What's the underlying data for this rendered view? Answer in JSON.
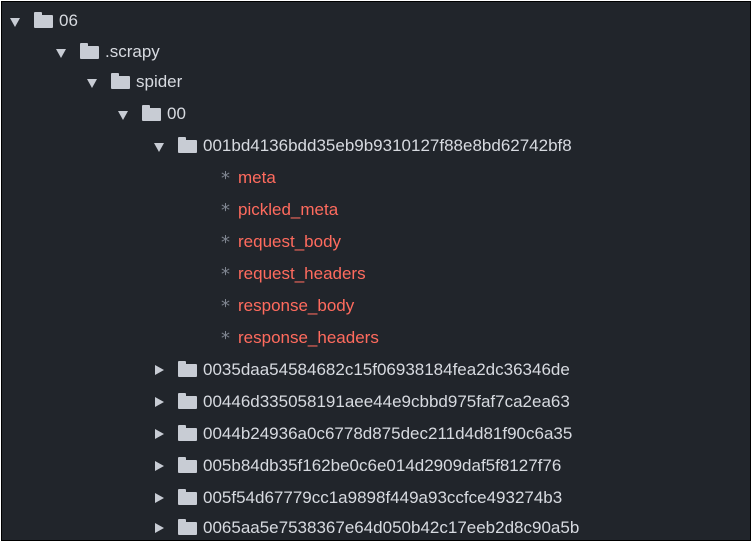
{
  "tree": {
    "root": {
      "name": "06",
      "icon": "folder-icon",
      "state": "expanded"
    },
    "scrapy": {
      "name": ".scrapy",
      "icon": "folder-icon",
      "state": "expanded"
    },
    "spider": {
      "name": "spider",
      "icon": "folder-icon",
      "state": "expanded"
    },
    "dir00": {
      "name": "00",
      "icon": "folder-icon",
      "state": "expanded"
    },
    "open_dir": {
      "name": "001bd4136bdd35eb9b9310127f88e8bd62742bf8",
      "icon": "folder-icon",
      "state": "expanded",
      "files": [
        {
          "marker": "*",
          "name": "meta"
        },
        {
          "marker": "*",
          "name": "pickled_meta"
        },
        {
          "marker": "*",
          "name": "request_body"
        },
        {
          "marker": "*",
          "name": "request_headers"
        },
        {
          "marker": "*",
          "name": "response_body"
        },
        {
          "marker": "*",
          "name": "response_headers"
        }
      ]
    },
    "collapsed_dirs": [
      "0035daa54584682c15f06938184fea2dc36346de",
      "00446d335058191aee44e9cbbd975faf7ca2ea63",
      "0044b24936a0c6778d875dec211d4d81f90c6a35",
      "005b84db35f162be0c6e014d2909daf5f8127f76",
      "005f54d67779cc1a9898f449a93ccfce493274b3",
      "0065aa5e7538367e64d050b42c17eeb2d8c90a5b"
    ]
  },
  "colors": {
    "background": "#21252b",
    "text": "#d7dae0",
    "modified_file": "#ff6b5e",
    "icon": "#c8ccd4"
  }
}
